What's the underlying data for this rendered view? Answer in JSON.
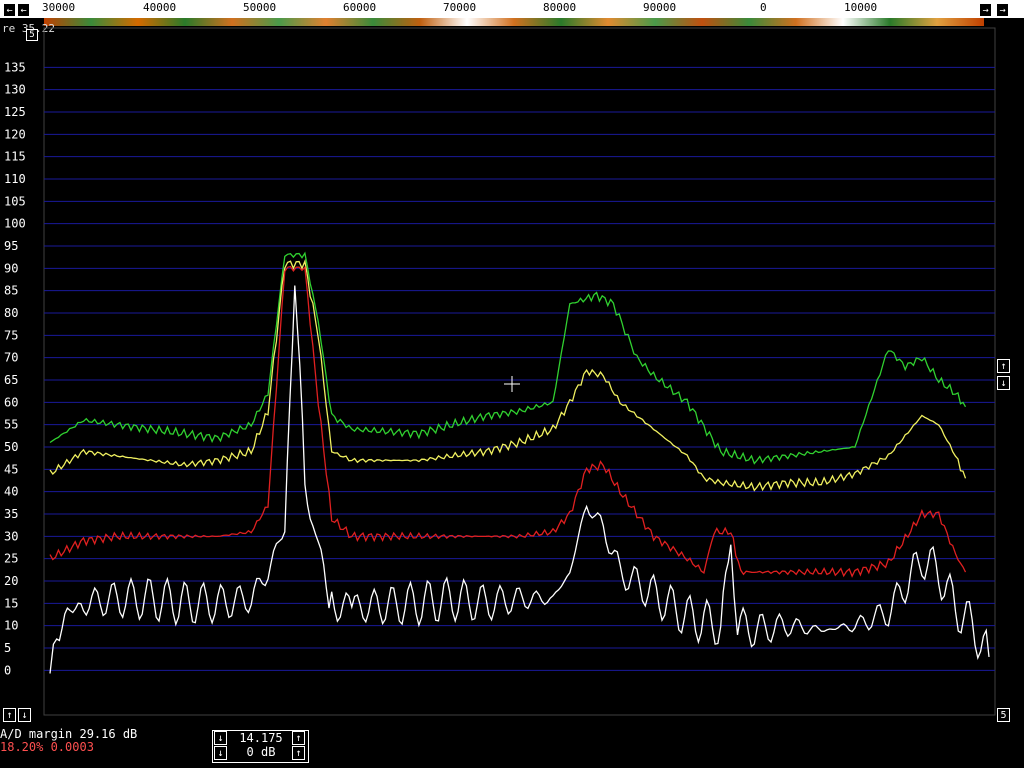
{
  "freq_axis": {
    "labels": [
      "30000",
      "40000",
      "50000",
      "60000",
      "70000",
      "80000",
      "90000",
      "0",
      "10000"
    ]
  },
  "overlay_text": "re 35.22",
  "corner_box_label": "5",
  "status": {
    "ad_margin": "A/D margin 29.16 dB",
    "ratio": "18.20% 0.0003",
    "ratio_color": "#ff5050"
  },
  "tuner": {
    "frequency": "14.175",
    "gain": "0 dB"
  },
  "buttons": {
    "left_arrow": "←",
    "right_arrow": "→",
    "up_arrow": "↑",
    "down_arrow": "↓",
    "bottom_right_label": "5"
  },
  "chart_data": {
    "type": "line",
    "ylim": [
      -10,
      140
    ],
    "y_ticks": [
      0,
      5,
      10,
      15,
      20,
      25,
      30,
      35,
      40,
      45,
      50,
      55,
      60,
      65,
      70,
      75,
      80,
      85,
      90,
      95,
      100,
      105,
      110,
      115,
      120,
      125,
      130,
      135
    ],
    "x_labels": [
      "30000",
      "40000",
      "50000",
      "60000",
      "70000",
      "80000",
      "90000",
      "0",
      "10000"
    ],
    "grid": true,
    "colors": {
      "grid": "#1a1a9a",
      "green": "#30d030",
      "yellow": "#f0f060",
      "red": "#e02020",
      "white": "#ffffff"
    },
    "series": [
      {
        "color": "green",
        "values": [
          [
            0,
            51
          ],
          [
            1,
            56
          ],
          [
            2,
            55
          ],
          [
            3,
            54
          ],
          [
            4,
            53
          ],
          [
            5,
            52
          ],
          [
            6,
            55
          ],
          [
            6.5,
            62
          ],
          [
            7,
            93
          ],
          [
            7.6,
            93
          ],
          [
            8,
            78
          ],
          [
            8.4,
            57
          ],
          [
            9,
            54
          ],
          [
            11,
            53
          ],
          [
            12,
            55
          ],
          [
            13,
            57
          ],
          [
            14,
            58
          ],
          [
            15,
            60
          ],
          [
            15.5,
            82
          ],
          [
            16.3,
            84
          ],
          [
            16.8,
            82
          ],
          [
            17.5,
            70
          ],
          [
            18,
            66
          ],
          [
            19,
            60
          ],
          [
            20,
            49
          ],
          [
            21,
            47
          ],
          [
            22,
            48
          ],
          [
            23,
            49
          ],
          [
            24,
            50
          ],
          [
            25,
            72
          ],
          [
            25.5,
            68
          ],
          [
            26,
            70
          ],
          [
            26.5,
            65
          ],
          [
            27,
            62
          ],
          [
            27.3,
            59
          ]
        ]
      },
      {
        "color": "yellow",
        "values": [
          [
            0,
            44
          ],
          [
            1,
            49
          ],
          [
            2,
            48
          ],
          [
            3,
            47
          ],
          [
            4,
            46
          ],
          [
            5,
            47
          ],
          [
            6,
            49
          ],
          [
            6.5,
            58
          ],
          [
            7,
            91
          ],
          [
            7.6,
            91
          ],
          [
            8,
            75
          ],
          [
            8.4,
            49
          ],
          [
            9,
            47
          ],
          [
            11,
            47
          ],
          [
            12,
            48
          ],
          [
            13,
            49
          ],
          [
            14,
            51
          ],
          [
            15,
            54
          ],
          [
            15.5,
            60
          ],
          [
            16,
            67
          ],
          [
            16.5,
            66
          ],
          [
            17,
            60
          ],
          [
            18,
            54
          ],
          [
            19,
            48
          ],
          [
            19.5,
            43
          ],
          [
            20,
            42
          ],
          [
            21,
            41
          ],
          [
            22,
            42
          ],
          [
            23,
            42
          ],
          [
            24,
            44
          ],
          [
            25,
            48
          ],
          [
            26,
            57
          ],
          [
            26.5,
            55
          ],
          [
            27,
            48
          ],
          [
            27.3,
            43
          ]
        ]
      },
      {
        "color": "red",
        "values": [
          [
            0,
            25
          ],
          [
            1,
            29
          ],
          [
            2,
            30
          ],
          [
            3,
            30
          ],
          [
            4,
            30
          ],
          [
            5,
            30
          ],
          [
            6,
            31
          ],
          [
            6.5,
            37
          ],
          [
            7,
            90
          ],
          [
            7.6,
            90
          ],
          [
            8,
            60
          ],
          [
            8.4,
            34
          ],
          [
            9,
            30
          ],
          [
            11,
            30
          ],
          [
            12,
            30
          ],
          [
            13,
            30
          ],
          [
            14,
            30
          ],
          [
            15,
            31
          ],
          [
            15.5,
            35
          ],
          [
            16,
            45
          ],
          [
            16.5,
            46
          ],
          [
            17,
            40
          ],
          [
            17.5,
            35
          ],
          [
            18,
            30
          ],
          [
            19,
            25
          ],
          [
            19.5,
            22
          ],
          [
            19.8,
            31
          ],
          [
            20.3,
            31
          ],
          [
            20.6,
            22
          ],
          [
            21,
            22
          ],
          [
            22,
            22
          ],
          [
            23,
            22
          ],
          [
            24,
            22
          ],
          [
            25,
            24
          ],
          [
            26,
            35
          ],
          [
            26.5,
            35
          ],
          [
            27,
            26
          ],
          [
            27.3,
            22
          ]
        ]
      },
      {
        "color": "white",
        "values": [
          [
            0,
            0
          ],
          [
            0.2,
            10
          ],
          [
            1,
            15
          ],
          [
            2,
            16
          ],
          [
            3,
            16
          ],
          [
            4,
            15
          ],
          [
            5,
            15
          ],
          [
            6,
            16
          ],
          [
            6.5,
            22
          ],
          [
            7,
            32
          ],
          [
            7.3,
            90
          ],
          [
            7.6,
            40
          ],
          [
            8,
            28
          ],
          [
            8.4,
            15
          ],
          [
            9,
            14
          ],
          [
            11,
            15
          ],
          [
            12,
            16
          ],
          [
            13,
            15
          ],
          [
            14,
            16
          ],
          [
            15,
            16
          ],
          [
            15.5,
            22
          ],
          [
            16,
            37
          ],
          [
            16.5,
            32
          ],
          [
            17,
            22
          ],
          [
            18,
            17
          ],
          [
            19,
            12
          ],
          [
            20,
            10
          ],
          [
            20.3,
            28
          ],
          [
            20.5,
            10
          ],
          [
            21,
            9
          ],
          [
            22,
            10
          ],
          [
            23,
            9
          ],
          [
            24,
            10
          ],
          [
            25,
            13
          ],
          [
            26,
            25
          ],
          [
            26.5,
            22
          ],
          [
            27,
            14
          ],
          [
            27.5,
            10
          ],
          [
            28,
            3
          ]
        ]
      }
    ]
  }
}
